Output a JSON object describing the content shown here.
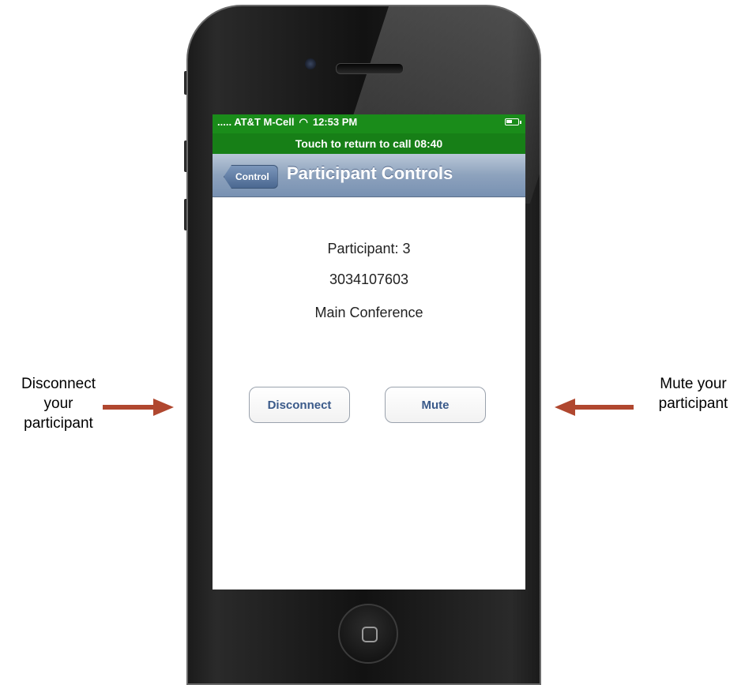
{
  "annotations": {
    "left": [
      "Disconnect",
      "your",
      "participant"
    ],
    "right": [
      "Mute your",
      "participant"
    ],
    "arrow_color": "#b0472f"
  },
  "status_bar": {
    "carrier": "..... AT&T M-Cell",
    "time": "12:53 PM",
    "color": "#1a8c1a"
  },
  "call_bar": {
    "text": "Touch to return to call  08:40"
  },
  "nav": {
    "back_label": "Control",
    "title": "Participant Controls"
  },
  "participant": {
    "label": "Participant: 3",
    "number": "3034107603",
    "conference": "Main Conference"
  },
  "buttons": {
    "disconnect": "Disconnect",
    "mute": "Mute"
  }
}
